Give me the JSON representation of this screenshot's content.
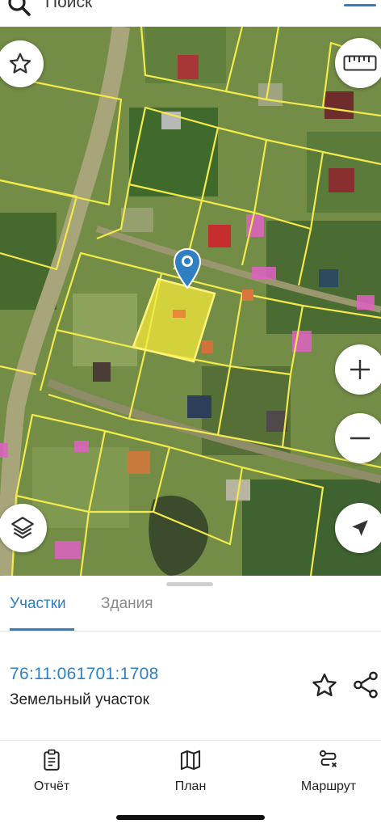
{
  "search": {
    "placeholder": "Поиск",
    "icon": "search-icon"
  },
  "toolbar": {
    "menu_icon": "menu-icon",
    "favorite_icon": "star-icon",
    "ruler_icon": "ruler-icon",
    "layers_icon": "layers-icon",
    "zoom_in_icon": "plus-icon",
    "zoom_out_icon": "minus-icon",
    "locate_icon": "location-arrow-icon"
  },
  "colors": {
    "accent": "#2f7fc2",
    "parcel_border": "#f2ea4b",
    "selected_parcel": "#f3ea3a",
    "building": "#e860c8"
  },
  "sheet": {
    "tabs": [
      {
        "label": "Участки",
        "active": true
      },
      {
        "label": "Здания",
        "active": false
      }
    ],
    "parcel": {
      "cadastral_number": "76:11:061701:1708",
      "type": "Земельный участок"
    }
  },
  "bottom_nav": [
    {
      "label": "Отчёт",
      "icon": "report-icon"
    },
    {
      "label": "План",
      "icon": "map-icon"
    },
    {
      "label": "Маршрут",
      "icon": "route-icon"
    }
  ]
}
